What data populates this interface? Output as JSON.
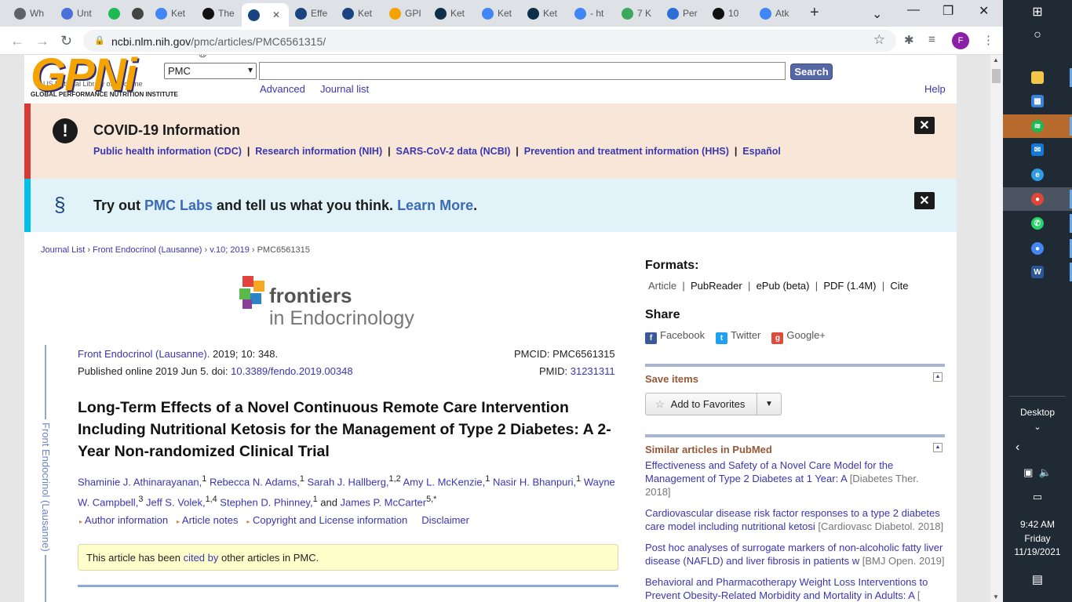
{
  "browser": {
    "tabs": [
      {
        "label": "Wh",
        "favicon": "chrome-icon",
        "color": "#5f6368"
      },
      {
        "label": "Unt",
        "favicon": "docs-icon",
        "color": "#4a70d9"
      },
      {
        "label": "",
        "favicon": "spotify-icon",
        "color": "#1db954"
      },
      {
        "label": "",
        "favicon": "speaker-icon",
        "color": "#444"
      },
      {
        "label": "Ket",
        "favicon": "google-icon",
        "color": "#4285f4"
      },
      {
        "label": "The",
        "favicon": "black-circle-icon",
        "color": "#111"
      },
      {
        "label": "",
        "favicon": "ncbi-icon",
        "color": "#1a4480",
        "active": true
      },
      {
        "label": "Effe",
        "favicon": "ncbi-icon",
        "color": "#1a4480"
      },
      {
        "label": "Ket",
        "favicon": "ncbi-icon",
        "color": "#1a4480"
      },
      {
        "label": "GPI",
        "favicon": "gpni-icon",
        "color": "#f4a300"
      },
      {
        "label": "Ket",
        "favicon": "dark-triangle-icon",
        "color": "#0d2f4a"
      },
      {
        "label": "Ket",
        "favicon": "google-icon",
        "color": "#4285f4"
      },
      {
        "label": "Ket",
        "favicon": "dark-triangle-icon",
        "color": "#0d2f4a"
      },
      {
        "label": "- ht",
        "favicon": "google-icon",
        "color": "#4285f4"
      },
      {
        "label": "7 K",
        "favicon": "leaf-icon",
        "color": "#3ca85b"
      },
      {
        "label": "Per",
        "favicon": "link-icon",
        "color": "#2d6fd6"
      },
      {
        "label": "10",
        "favicon": "black-circle-icon",
        "color": "#111"
      },
      {
        "label": "Atk",
        "favicon": "google-icon",
        "color": "#4285f4"
      }
    ],
    "url_host": "ncbi.nlm.nih.gov",
    "url_path": "/pmc/articles/PMC6561315/",
    "profile_initial": "F"
  },
  "header": {
    "logo_text": "GPNi",
    "logo_reg": "®",
    "logo_sub": "GLOBAL PERFORMANCE NUTRITION INSTITUTE",
    "nlm_text": "US National Library of Medicine",
    "db_select": "PMC",
    "search_label": "Search",
    "advanced": "Advanced",
    "journal_list": "Journal list",
    "help": "Help"
  },
  "covid": {
    "title": "COVID-19 Information",
    "links": [
      "Public health information (CDC)",
      "Research information (NIH)",
      "SARS-CoV-2 data (NCBI)",
      "Prevention and treatment information (HHS)",
      "Español"
    ]
  },
  "labs": {
    "prefix": "Try out ",
    "link1": "PMC Labs",
    "middle": " and tell us what you think. ",
    "link2": "Learn More",
    "suffix": "."
  },
  "breadcrumb": {
    "items": [
      "Journal List",
      "Front Endocrinol (Lausanne)",
      "v.10; 2019"
    ],
    "current": "PMC6561315"
  },
  "journal_logo": {
    "line1": "frontiers",
    "line2": "in Endocrinology"
  },
  "sidebar_journal": "Front Endocrinol (Lausanne)",
  "citation": {
    "journal": "Front Endocrinol (Lausanne).",
    "details": " 2019; 10: 348.",
    "published": "Published online 2019 Jun 5. doi: ",
    "doi": "10.3389/fendo.2019.00348",
    "pmcid": "PMCID: PMC6561315",
    "pmid_label": "PMID: ",
    "pmid": "31231311"
  },
  "article": {
    "title": "Long-Term Effects of a Novel Continuous Remote Care Intervention Including Nutritional Ketosis for the Management of Type 2 Diabetes: A 2-Year Non-randomized Clinical Trial",
    "authors": [
      {
        "name": "Shaminie J. Athinarayanan,",
        "sup": "1"
      },
      {
        "name": "Rebecca N. Adams,",
        "sup": "1"
      },
      {
        "name": "Sarah J. Hallberg,",
        "sup": "1,2"
      },
      {
        "name": "Amy L. McKenzie,",
        "sup": "1"
      },
      {
        "name": "Nasir H. Bhanpuri,",
        "sup": "1"
      },
      {
        "name": "Wayne W. Campbell,",
        "sup": "3"
      },
      {
        "name": "Jeff S. Volek,",
        "sup": "1,4"
      },
      {
        "name": "Stephen D. Phinney,",
        "sup": "1"
      },
      {
        "name": "James P. McCarter",
        "sup": "5,*"
      }
    ],
    "and": " and ",
    "links": [
      "Author information",
      "Article notes",
      "Copyright and License information"
    ],
    "disclaimer": "Disclaimer",
    "cited_prefix": "This article has been ",
    "cited_link": "cited by",
    "cited_suffix": " other articles in PMC."
  },
  "sidebar": {
    "formats_title": "Formats:",
    "formats": [
      "Article",
      "PubReader",
      "ePub (beta)",
      "PDF (1.4M)",
      "Cite"
    ],
    "share_title": "Share",
    "share": [
      "Facebook",
      "Twitter",
      "Google+"
    ],
    "save_title": "Save items",
    "favorites": "Add to Favorites",
    "similar_title": "Similar articles in PubMed",
    "similar": [
      {
        "text": "Effectiveness and Safety of a Novel Care Model for the Management of Type 2 Diabetes at 1 Year: A",
        "src": "[Diabetes Ther. 2018]"
      },
      {
        "text": "Cardiovascular disease risk factor responses to a type 2 diabetes care model including nutritional ketosi",
        "src": "[Cardiovasc Diabetol. 2018]"
      },
      {
        "text": "Post hoc analyses of surrogate markers of non-alcoholic fatty liver disease (NAFLD) and liver fibrosis in patients w",
        "src": "[BMJ Open. 2019]"
      },
      {
        "text": "Behavioral and Pharmacotherapy Weight Loss Interventions to Prevent Obesity-Related Morbidity and Mortality in Adults: A",
        "src": "[ 2018]"
      }
    ]
  },
  "taskbar": {
    "desktop": "Desktop",
    "time": "9:42 AM",
    "day": "Friday",
    "date": "11/19/2021"
  }
}
